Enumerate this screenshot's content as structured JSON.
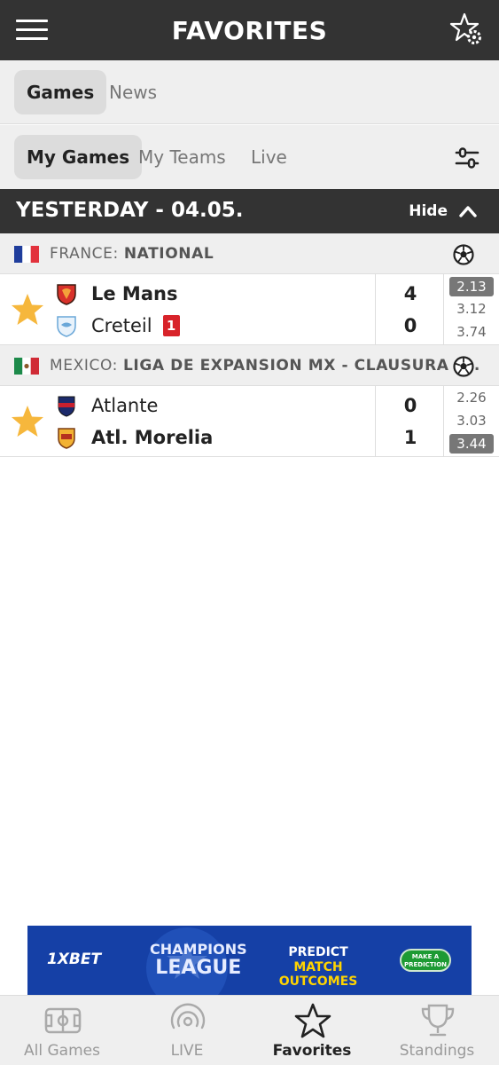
{
  "header": {
    "title": "FAVORITES",
    "menu_icon": "hamburger-menu-icon",
    "settings_icon": "star-gear-icon"
  },
  "top_tabs": [
    {
      "label": "Games",
      "active": true
    },
    {
      "label": "News",
      "active": false
    }
  ],
  "sub_tabs": [
    {
      "label": "My Games",
      "active": true
    },
    {
      "label": "My Teams",
      "active": false
    },
    {
      "label": "Live",
      "active": false
    }
  ],
  "filter_icon": "sliders-icon",
  "section": {
    "date_label": "YESTERDAY - 04.05.",
    "toggle_label": "Hide",
    "toggle_icon": "chevron-up-icon"
  },
  "leagues": [
    {
      "country": "FRANCE:",
      "name": "NATIONAL",
      "flag": "france-flag",
      "game": {
        "home": {
          "name": "Le Mans",
          "winner": true,
          "red_cards": ""
        },
        "away": {
          "name": "Creteil",
          "winner": false,
          "red_cards": "1"
        },
        "score_home": "4",
        "score_away": "0",
        "odds": [
          "2.13",
          "3.12",
          "3.74"
        ],
        "highlighted_odd": 0
      }
    },
    {
      "country": "MEXICO:",
      "name": "LIGA DE EXPANSION MX - CLAUSURA -...",
      "flag": "mexico-flag",
      "game": {
        "home": {
          "name": "Atlante",
          "winner": false,
          "red_cards": ""
        },
        "away": {
          "name": "Atl. Morelia",
          "winner": true,
          "red_cards": ""
        },
        "score_home": "0",
        "score_away": "1",
        "odds": [
          "2.26",
          "3.03",
          "3.44"
        ],
        "highlighted_odd": 2
      }
    }
  ],
  "ad": {
    "brand": "1XBET",
    "title_line1": "CHAMPIONS",
    "title_line2": "LEAGUE",
    "predict_line1": "PREDICT",
    "predict_line2": "MATCH OUTCOMES",
    "button_line1": "MAKE A",
    "button_line2": "PREDICTION",
    "colors": {
      "background": "#1540a6",
      "accent": "#ffd400",
      "button": "#1d9a33"
    }
  },
  "bottom_nav": [
    {
      "label": "All Games",
      "icon": "field-icon",
      "active": false
    },
    {
      "label": "LIVE",
      "icon": "live-broadcast-icon",
      "active": false
    },
    {
      "label": "Favorites",
      "icon": "star-icon",
      "active": true
    },
    {
      "label": "Standings",
      "icon": "trophy-icon",
      "active": false
    }
  ],
  "colors": {
    "header_bg": "#333333",
    "star": "#f6b73c",
    "red_card": "#d8232a",
    "panel_bg": "#efefef"
  }
}
